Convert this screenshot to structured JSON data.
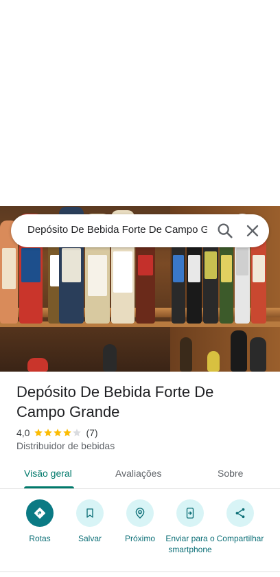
{
  "search": {
    "query": "Depósito De Bebida Forte De Campo Grande"
  },
  "place": {
    "title": "Depósito De Bebida Forte De Campo Grande",
    "rating": "4,0",
    "stars": 4,
    "review_count": "(7)",
    "category": "Distribuidor de bebidas"
  },
  "tabs": [
    {
      "label": "Visão geral"
    },
    {
      "label": "Avaliações"
    },
    {
      "label": "Sobre"
    }
  ],
  "actions": [
    {
      "label": "Rotas",
      "icon": "directions-icon"
    },
    {
      "label": "Salvar",
      "icon": "bookmark-icon"
    },
    {
      "label": "Próximo",
      "icon": "nearby-icon"
    },
    {
      "label": "Enviar para o smartphone",
      "icon": "send-to-phone-icon"
    },
    {
      "label": "Compartilhar",
      "icon": "share-icon"
    }
  ],
  "colors": {
    "accent": "#00796b",
    "action_bg": "#d8f4f6",
    "primary_action_bg": "#0b7a84",
    "star": "#fbbc04"
  }
}
